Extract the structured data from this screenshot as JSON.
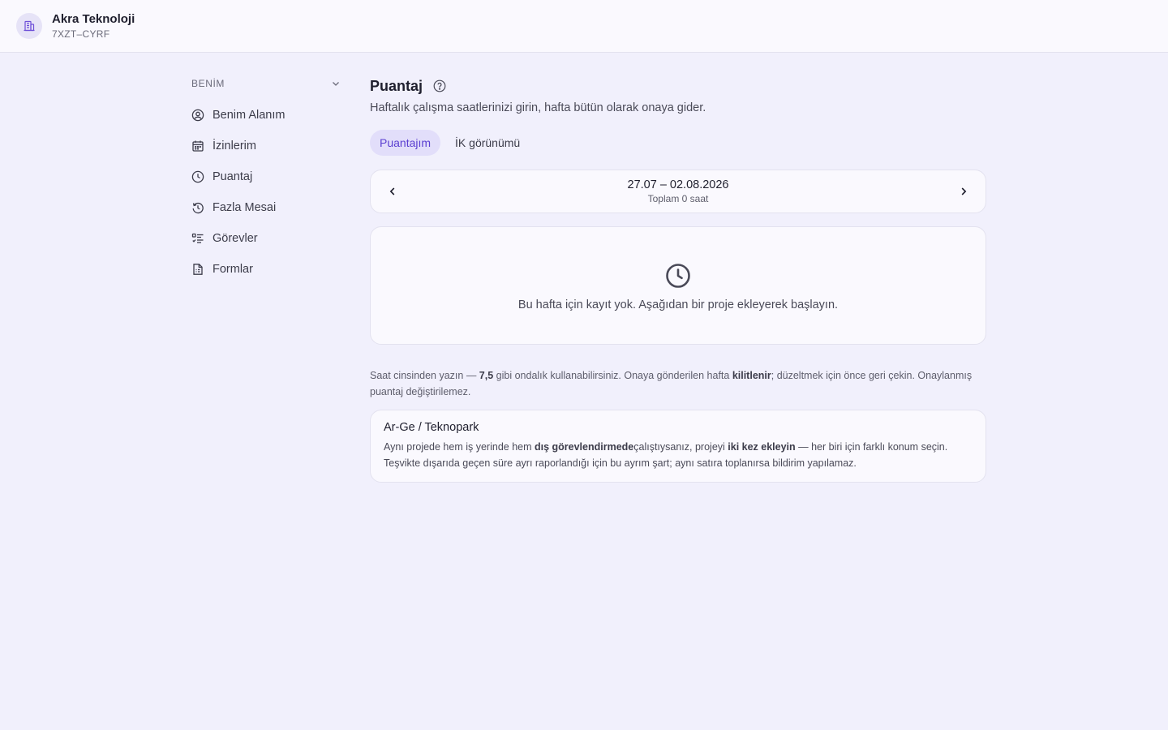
{
  "org": {
    "name": "Akra Teknoloji",
    "code": "7XZT–CYRF"
  },
  "sidebar": {
    "section_title": "BENİM",
    "items": [
      {
        "label": "Benim Alanım",
        "icon": "user-circle-icon"
      },
      {
        "label": "İzinlerim",
        "icon": "calendar-icon"
      },
      {
        "label": "Puantaj",
        "icon": "clock-icon"
      },
      {
        "label": "Fazla Mesai",
        "icon": "history-icon"
      },
      {
        "label": "Görevler",
        "icon": "task-list-icon"
      },
      {
        "label": "Formlar",
        "icon": "document-icon"
      }
    ]
  },
  "main": {
    "title": "Puantaj",
    "subtitle": "Haftalık çalışma saatlerinizi girin, hafta bütün olarak onaya gider.",
    "tabs": [
      {
        "label": "Puantajım",
        "active": true
      },
      {
        "label": "İK görünümü",
        "active": false
      }
    ],
    "week": {
      "range": "27.07 – 02.08.2026",
      "total": "Toplam 0 saat"
    },
    "empty_text": "Bu hafta için kayıt yok. Aşağıdan bir proje ekleyerek başlayın.",
    "hint": {
      "p1": "Saat cinsinden yazın — ",
      "b1": "7,5",
      "p2": " gibi ondalık kullanabilirsiniz. Onaya gönderilen hafta ",
      "b2": "kilitlenir",
      "p3": "; düzeltmek için önce geri çekin. Onaylanmış puantaj değiştirilemez."
    },
    "info": {
      "title": "Ar-Ge / Teknopark",
      "p1": "Aynı projede hem iş yerinde hem ",
      "b1": "dış görevlendirmede",
      "p2": "çalıştıysanız, projeyi ",
      "b2": "iki kez ekleyin",
      "p3": " — her biri için farklı konum seçin. Teşvikte dışarıda geçen süre ayrı raporlandığı için bu ayrım şart; aynı satıra toplanırsa bildirim yapılamaz."
    }
  },
  "colors": {
    "accent": "#5b3fd1",
    "accent_bg": "#e2defa",
    "background": "#f1f0fc"
  }
}
